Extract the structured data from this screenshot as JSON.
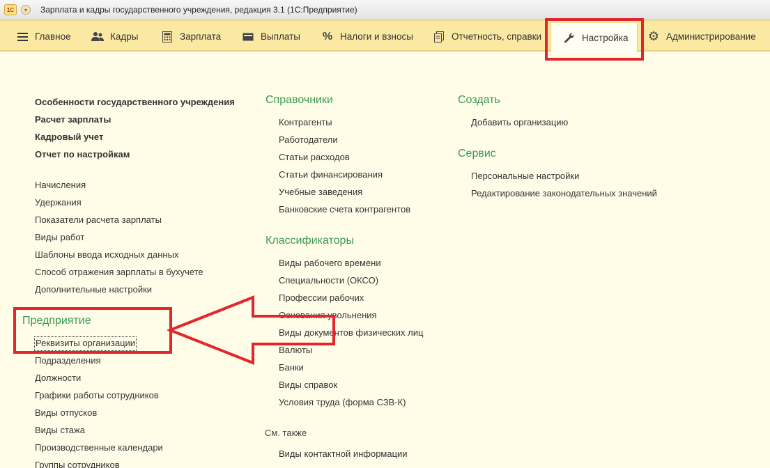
{
  "window": {
    "logo_text": "1С",
    "menu_glyph": "▾",
    "title": "Зарплата и кадры государственного учреждения, редакция 3.1  (1С:Предприятие)"
  },
  "sections": [
    {
      "label": "Главное",
      "icon": "hamburger-icon"
    },
    {
      "label": "Кадры",
      "icon": "users-icon"
    },
    {
      "label": "Зарплата",
      "icon": "calculator-icon"
    },
    {
      "label": "Выплаты",
      "icon": "wallet-icon"
    },
    {
      "label": "Налоги и взносы",
      "icon": "percent-icon"
    },
    {
      "label": "Отчетность, справки",
      "icon": "documents-icon"
    },
    {
      "label": "Настройка",
      "icon": "wrench-icon",
      "active": true
    },
    {
      "label": "Администрирование",
      "icon": "gear-icon"
    }
  ],
  "col1": {
    "bold_items": [
      "Особенности государственного учреждения",
      "Расчет зарплаты",
      "Кадровый учет",
      "Отчет по настройкам"
    ],
    "items": [
      "Начисления",
      "Удержания",
      "Показатели расчета зарплаты",
      "Виды работ",
      "Шаблоны ввода исходных данных",
      "Способ отражения зарплаты в бухучете",
      "Дополнительные настройки"
    ],
    "enterprise": {
      "title": "Предприятие",
      "items": [
        "Реквизиты организации",
        "Подразделения",
        "Должности",
        "Графики работы сотрудников",
        "Виды отпусков",
        "Виды стажа",
        "Производственные календари",
        "Группы сотрудников"
      ]
    }
  },
  "col2": {
    "directories": {
      "title": "Справочники",
      "items": [
        "Контрагенты",
        "Работодатели",
        "Статьи расходов",
        "Статьи финансирования",
        "Учебные заведения",
        "Банковские счета контрагентов"
      ]
    },
    "classifiers": {
      "title": "Классификаторы",
      "items": [
        "Виды рабочего времени",
        "Специальности (ОКСО)",
        "Профессии рабочих",
        "Основания увольнения",
        "Виды документов физических лиц",
        "Валюты",
        "Банки",
        "Виды справок",
        "Условия труда (форма СЗВ-К)"
      ]
    },
    "see_also": {
      "title": "См. также",
      "items": [
        "Виды контактной информации"
      ]
    }
  },
  "col3": {
    "create": {
      "title": "Создать",
      "items": [
        "Добавить организацию"
      ]
    },
    "service": {
      "title": "Сервис",
      "items": [
        "Персональные настройки",
        "Редактирование законодательных значений"
      ]
    }
  },
  "colors": {
    "accent_green": "#3a9a52",
    "panel_yellow": "#fbe9a3",
    "annotation_red": "#e3262c"
  }
}
